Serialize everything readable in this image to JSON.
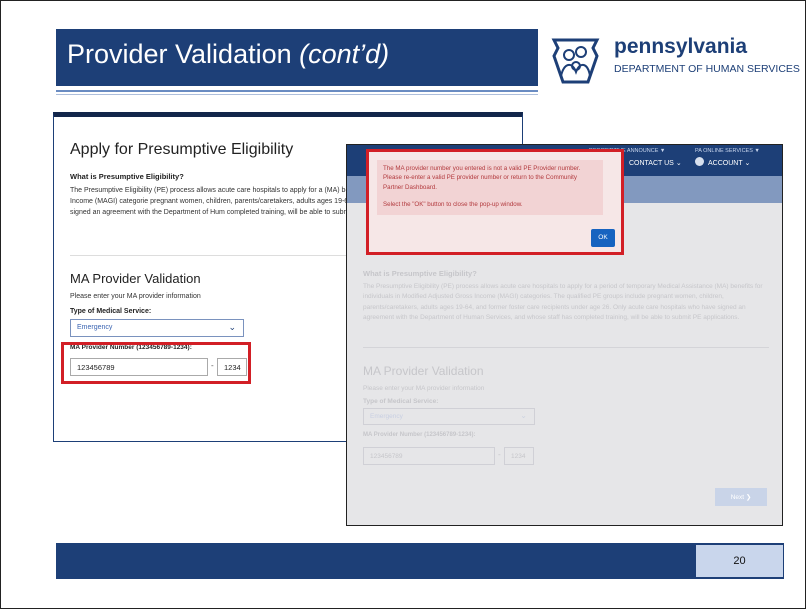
{
  "slide": {
    "title_main": "Provider Validation ",
    "title_italic": "(cont’d)",
    "page_number": "20",
    "colors": {
      "brand_navy": "#1d3f77",
      "error_red": "#d21f26",
      "ok_blue": "#1663c0"
    }
  },
  "logo": {
    "name": "pennsylvania",
    "department": "DEPARTMENT OF HUMAN SERVICES",
    "icon": "pa-keystone-family-logo"
  },
  "left_screen": {
    "heading": "Apply for Presumptive Eligibility",
    "what_heading": "What is Presumptive Eligibility?",
    "what_text": "The Presumptive Eligibility (PE) process allows acute care hospitals to apply for a (MA) benefits for individuals in Modified Adjusted Gross Income (MAGI) categorie pregnant women, children, parents/caretakers, adults ages 19-64, and former fost acute care hospitals who have signed an agreement with the Department of Hum completed training, will be able to submit PE applications.",
    "section_heading": "MA Provider Validation",
    "enter_text": "Please enter your MA provider information",
    "service_label": "Type of Medical Service:",
    "service_value": "Emergency",
    "provider_label": "MA Provider Number (123456789-1234):",
    "provider_number": "123456789",
    "provider_suffix": "1234"
  },
  "right_screen": {
    "nav_left": "DESCRIPTIVE ANNOUNCE ▼",
    "nav_right": "PA ONLINE SERVICES ▼",
    "contact_us": "CONTACT US",
    "account": "ACCOUNT",
    "what_heading": "What is Presumptive Eligibility?",
    "what_text": "The Presumptive Eligibility (PE) process allows acute care hospitals to apply for a period of temporary Medical Assistance (MA) benefits for individuals in Modified Adjusted Gross Income (MAGI) categories. The qualified PE groups include pregnant women, children, parents/caretakers, adults ages 19-64, and former foster care recipients under age 26. Only acute care hospitals who have signed an agreement with the Department of Human Services, and whose staff has completed training, will be able to submit PE applications.",
    "section_heading": "MA Provider Validation",
    "enter_text": "Please enter your MA provider information",
    "service_label": "Type of Medical Service:",
    "service_value": "Emergency",
    "provider_label": "MA Provider Number (123456789-1234):",
    "provider_number": "123456789",
    "provider_suffix": "1234",
    "next_label": "Next ❯"
  },
  "popup": {
    "message_line1": "The MA provider number you entered is not a valid PE Provider number. Please re-enter a valid PE provider number or return to the Community Partner Dashboard.",
    "message_line2": "Select the \"OK\" button to close the pop-up window.",
    "ok_label": "OK"
  }
}
